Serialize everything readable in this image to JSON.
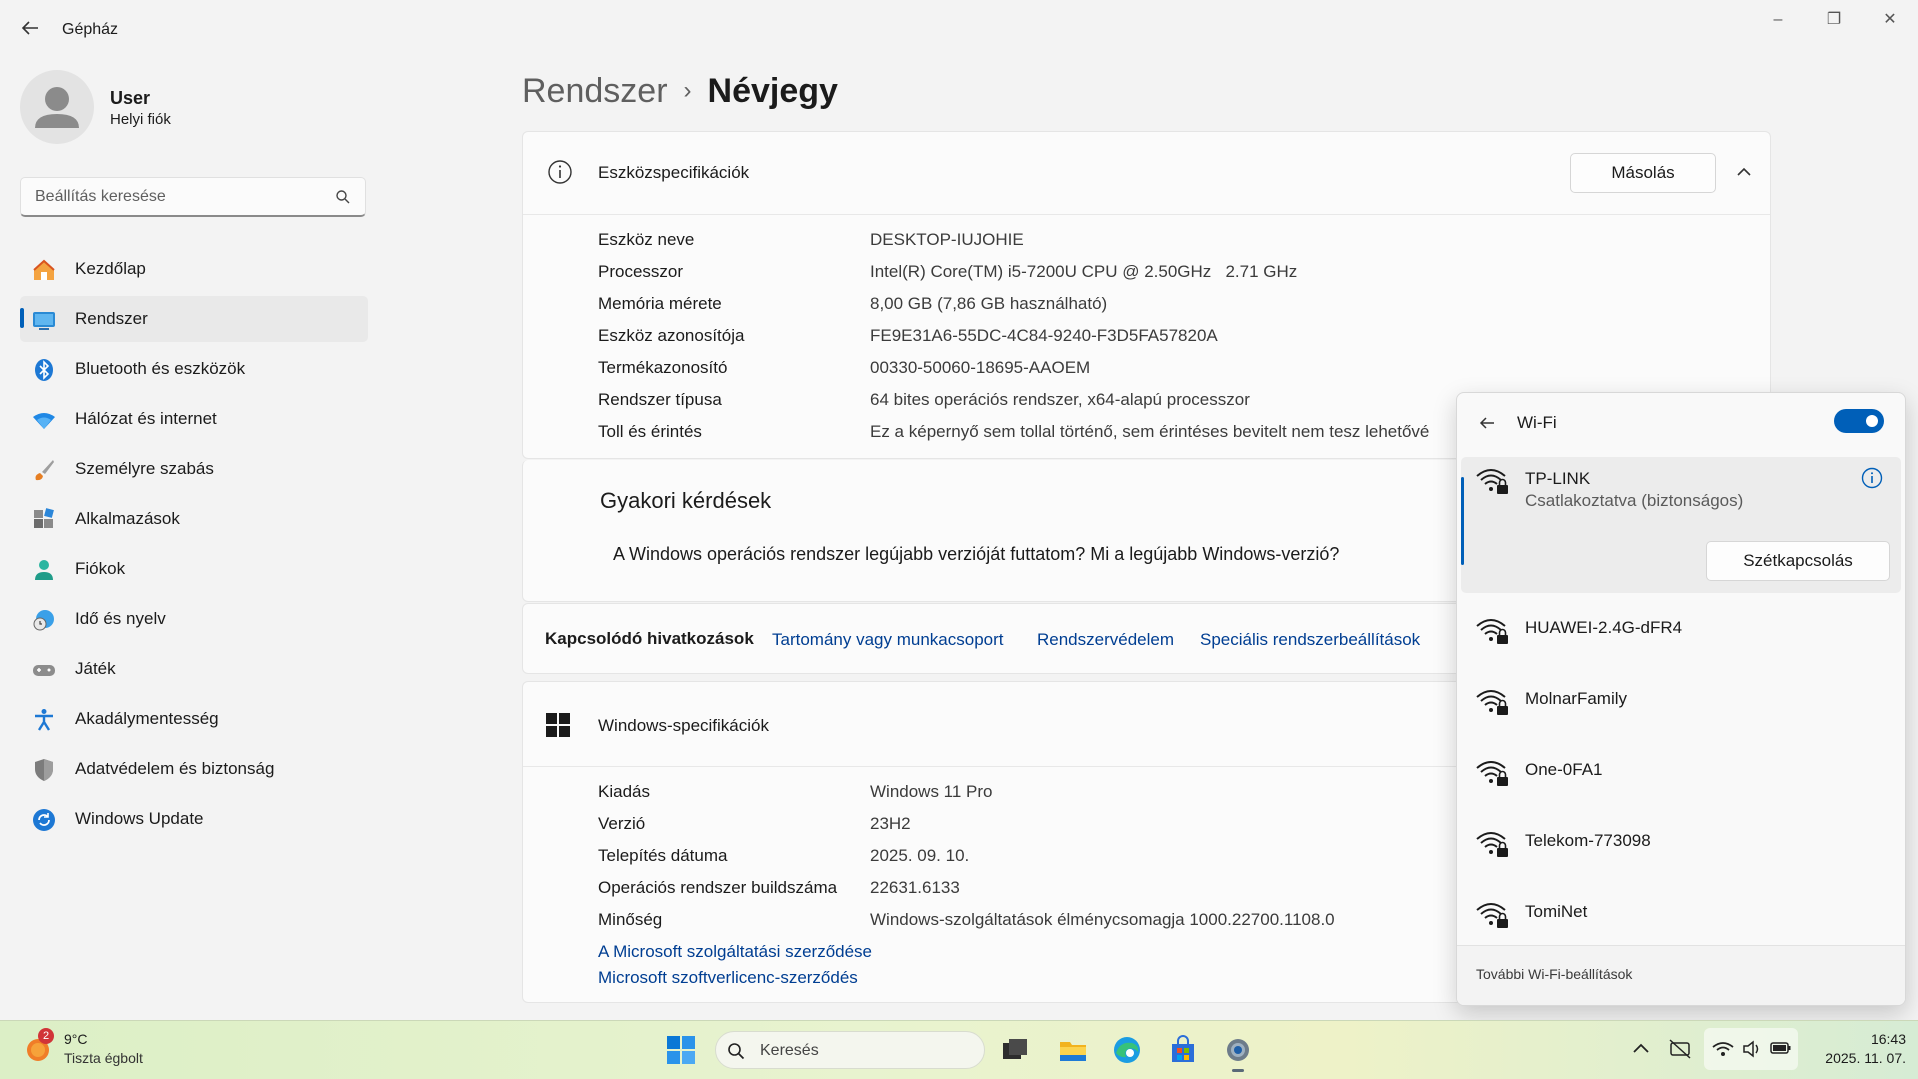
{
  "window": {
    "title": "Gépház"
  },
  "user": {
    "name": "User",
    "account_type": "Helyi fiók"
  },
  "search": {
    "placeholder": "Beállítás keresése"
  },
  "sidebar": {
    "items": [
      {
        "label": "Kezdőlap",
        "icon": "home-icon"
      },
      {
        "label": "Rendszer",
        "icon": "system-icon"
      },
      {
        "label": "Bluetooth és eszközök",
        "icon": "bluetooth-icon"
      },
      {
        "label": "Hálózat és internet",
        "icon": "wifi-icon"
      },
      {
        "label": "Személyre szabás",
        "icon": "brush-icon"
      },
      {
        "label": "Alkalmazások",
        "icon": "apps-icon"
      },
      {
        "label": "Fiókok",
        "icon": "person-icon"
      },
      {
        "label": "Idő és nyelv",
        "icon": "clock-globe-icon"
      },
      {
        "label": "Játék",
        "icon": "gamepad-icon"
      },
      {
        "label": "Akadálymentesség",
        "icon": "accessibility-icon"
      },
      {
        "label": "Adatvédelem és biztonság",
        "icon": "shield-icon"
      },
      {
        "label": "Windows Update",
        "icon": "update-icon"
      }
    ]
  },
  "breadcrumb": {
    "parent": "Rendszer",
    "separator": "›",
    "current": "Névjegy"
  },
  "device_specs": {
    "title": "Eszközspecifikációk",
    "copy_label": "Másolás",
    "rows": [
      {
        "label": "Eszköz neve",
        "value": "DESKTOP-IUJOHIE"
      },
      {
        "label": "Processzor",
        "value": "Intel(R) Core(TM) i5-7200U CPU @ 2.50GHz   2.71 GHz"
      },
      {
        "label": "Memória mérete",
        "value": "8,00 GB (7,86 GB használható)"
      },
      {
        "label": "Eszköz azonosítója",
        "value": "FE9E31A6-55DC-4C84-9240-F3D5FA57820A"
      },
      {
        "label": "Termékazonosító",
        "value": "00330-50060-18695-AAOEM"
      },
      {
        "label": "Rendszer típusa",
        "value": "64 bites operációs rendszer, x64-alapú processzor"
      },
      {
        "label": "Toll és érintés",
        "value": "Ez a képernyő sem tollal történő, sem érintéses bevitelt nem tesz lehetővé"
      }
    ]
  },
  "faq": {
    "title": "Gyakori kérdések",
    "question": "A Windows operációs rendszer legújabb verzióját futtatom? Mi a legújabb Windows-verzió?"
  },
  "related_links": {
    "label": "Kapcsolódó hivatkozások",
    "links": [
      "Tartomány vagy munkacsoport",
      "Rendszervédelem",
      "Speciális rendszerbeállítások"
    ]
  },
  "windows_specs": {
    "title": "Windows-specifikációk",
    "rows": [
      {
        "label": "Kiadás",
        "value": "Windows 11 Pro"
      },
      {
        "label": "Verzió",
        "value": "23H2"
      },
      {
        "label": "Telepítés dátuma",
        "value": "2025. 09. 10."
      },
      {
        "label": "Operációs rendszer buildszáma",
        "value": "22631.6133"
      },
      {
        "label": "Minőség",
        "value": "Windows-szolgáltatások élménycsomagja 1000.22700.1108.0"
      }
    ],
    "links": [
      "A Microsoft szolgáltatási szerződése",
      "Microsoft szoftverlicenc-szerződés"
    ]
  },
  "wifi_flyout": {
    "title": "Wi-Fi",
    "toggle_on": true,
    "connected": {
      "name": "TP-LINK",
      "status": "Csatlakoztatva (biztonságos)",
      "disconnect_label": "Szétkapcsolás"
    },
    "networks": [
      "HUAWEI-2.4G-dFR4",
      "MolnarFamily",
      "One-0FA1",
      "Telekom-773098",
      "TomiNet"
    ],
    "more_settings": "További Wi-Fi-beállítások"
  },
  "taskbar": {
    "weather": {
      "temp": "9°C",
      "condition": "Tiszta égbolt",
      "badge": "2"
    },
    "search_label": "Keresés",
    "time": "16:43",
    "date": "2025. 11. 07."
  },
  "colors": {
    "accent": "#005fb8",
    "link": "#003e92"
  }
}
